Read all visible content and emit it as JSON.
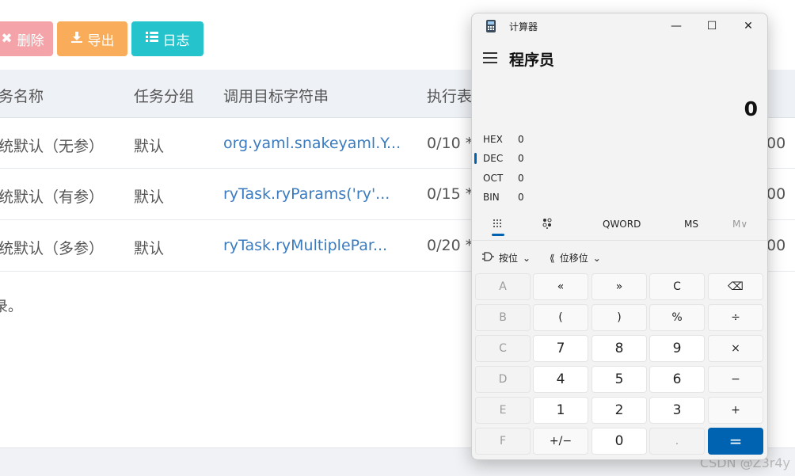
{
  "toolbar": {
    "delete_label": "删除",
    "export_label": "导出",
    "log_label": "日志"
  },
  "table": {
    "headers": [
      "务名称",
      "任务分组",
      "调用目标字符串",
      "执行表"
    ],
    "rows": [
      {
        "name": "统默认（无参）",
        "group": "默认",
        "target": "org.yaml.snakeyaml.Y...",
        "cron": "0/10 *",
        "tail": "00"
      },
      {
        "name": "统默认（有参）",
        "group": "默认",
        "target": "ryTask.ryParams('ry'...",
        "cron": "0/15 *",
        "tail": "00"
      },
      {
        "name": "统默认（多参）",
        "group": "默认",
        "target": "ryTask.ryMultiplePar...",
        "cron": "0/20 *",
        "tail": "00"
      }
    ],
    "records_note": "录。"
  },
  "watermark": "CSDN @Z3r4y",
  "calculator": {
    "app_title": "计算器",
    "mode_title": "程序员",
    "display_value": "0",
    "bases": [
      {
        "label": "HEX",
        "value": "0"
      },
      {
        "label": "DEC",
        "value": "0"
      },
      {
        "label": "OCT",
        "value": "0"
      },
      {
        "label": "BIN",
        "value": "0"
      }
    ],
    "word_size": "QWORD",
    "memory_store": "MS",
    "memory_menu": "M∨",
    "bitwise_label": "按位",
    "bitshift_label": "位移位",
    "keys": [
      [
        "A",
        "«",
        "»",
        "C",
        "⌫"
      ],
      [
        "B",
        "(",
        ")",
        "%",
        "÷"
      ],
      [
        "C",
        "7",
        "8",
        "9",
        "×"
      ],
      [
        "D",
        "4",
        "5",
        "6",
        "−"
      ],
      [
        "E",
        "1",
        "2",
        "3",
        "+"
      ],
      [
        "F",
        "+/−",
        "0",
        ".",
        "="
      ]
    ],
    "colors": {
      "accent": "#0063b1",
      "window_bg": "#f3f3f3"
    }
  }
}
